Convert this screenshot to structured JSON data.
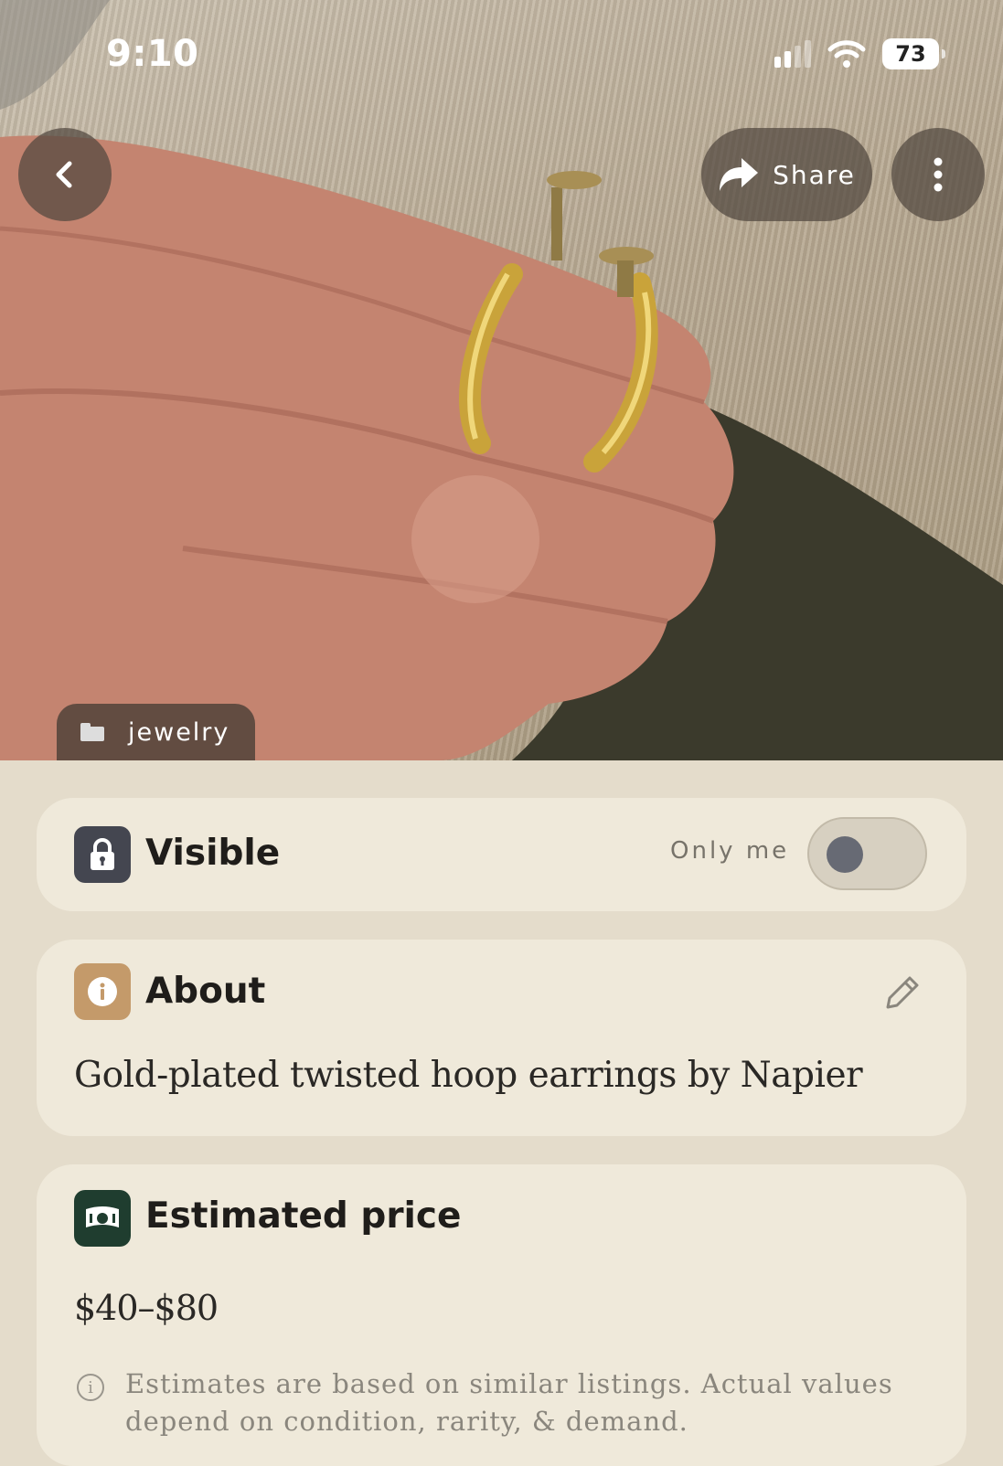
{
  "status_bar": {
    "time": "9:10",
    "battery": "73"
  },
  "hero": {
    "share_label": "Share",
    "category": "jewelry"
  },
  "visibility": {
    "title": "Visible",
    "toggle_label": "Only me",
    "toggle_on": false
  },
  "about": {
    "title": "About",
    "description": "Gold-plated twisted hoop earrings by Napier"
  },
  "price": {
    "title": "Estimated price",
    "range": "$40–$80",
    "disclaimer": "Estimates are based on similar listings. Actual values depend on condition, rarity, & demand."
  },
  "colors": {
    "page_background": "#e4dccb",
    "card_background": "#efe9da",
    "lock_icon_bg": "#444650",
    "info_icon_bg": "#c49a6a",
    "price_icon_bg": "#1f3d2f"
  }
}
